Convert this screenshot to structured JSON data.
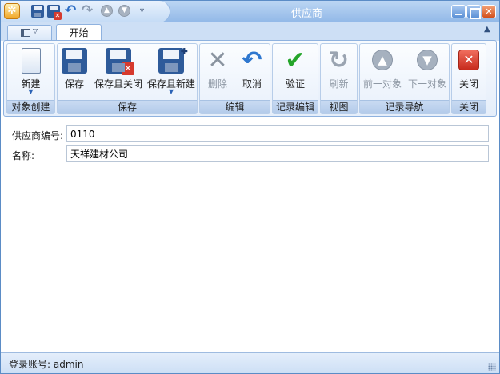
{
  "window": {
    "title": "供应商"
  },
  "quick_access": {
    "save": "save-icon",
    "save_close": "save-close-icon",
    "undo": "undo-icon",
    "redo": "redo-icon",
    "prev": "up-arrow-icon",
    "next": "down-arrow-icon",
    "more": "▿"
  },
  "tabs": [
    {
      "label": "开始"
    }
  ],
  "ribbon": {
    "groups": [
      {
        "label": "对象创建",
        "buttons": [
          {
            "label": "新建"
          }
        ]
      },
      {
        "label": "保存",
        "buttons": [
          {
            "label": "保存"
          },
          {
            "label": "保存且关闭"
          },
          {
            "label": "保存且新建"
          }
        ]
      },
      {
        "label": "编辑",
        "buttons": [
          {
            "label": "删除"
          },
          {
            "label": "取消"
          }
        ]
      },
      {
        "label": "记录编辑",
        "buttons": [
          {
            "label": "验证"
          }
        ]
      },
      {
        "label": "视图",
        "buttons": [
          {
            "label": "刷新"
          }
        ]
      },
      {
        "label": "记录导航",
        "buttons": [
          {
            "label": "前一对象"
          },
          {
            "label": "下一对象"
          }
        ]
      },
      {
        "label": "关闭",
        "buttons": [
          {
            "label": "关闭"
          }
        ]
      }
    ]
  },
  "form": {
    "supplier_code": {
      "label": "供应商编号:",
      "value": "0110"
    },
    "name": {
      "label": "名称:",
      "value": "天祥建材公司"
    }
  },
  "status": {
    "text": "登录账号: admin"
  },
  "colors": {
    "titlebar": "#93b9e8",
    "ribbon_border": "#8fb2df",
    "status_bg": "#cddff5"
  }
}
